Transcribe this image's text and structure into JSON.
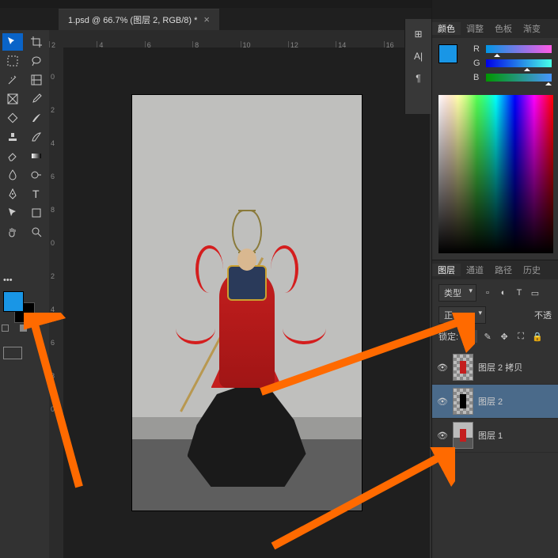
{
  "tab": {
    "title": "1.psd @ 66.7% (图层 2, RGB/8) *",
    "close": "×"
  },
  "ruler_h": [
    "2",
    "4",
    "6",
    "8",
    "10",
    "12",
    "14",
    "16"
  ],
  "ruler_v": [
    "0",
    "2",
    "4",
    "6",
    "8",
    "0",
    "2",
    "4",
    "6",
    "8",
    "0"
  ],
  "right_icons": {
    "a": "⊞",
    "b": "A|",
    "c": "¶"
  },
  "color_panel": {
    "tabs": {
      "active": "颜色",
      "t2": "调整",
      "t3": "色板",
      "t4": "渐变"
    },
    "r": "R",
    "g": "G",
    "b": "B"
  },
  "layers_panel": {
    "tabs": {
      "active": "图层",
      "t2": "通道",
      "t3": "路径",
      "t4": "历史"
    },
    "kind_label": "类型",
    "blend": "正",
    "opacity_label": "不透",
    "lock_label": "锁定:",
    "layers": [
      {
        "name": "图层 2 拷贝",
        "visible": true,
        "selected": false,
        "thumb": "trans-fig"
      },
      {
        "name": "图层 2",
        "visible": true,
        "selected": true,
        "thumb": "trans-sil"
      },
      {
        "name": "图层 1",
        "visible": true,
        "selected": false,
        "thumb": "full"
      }
    ]
  }
}
